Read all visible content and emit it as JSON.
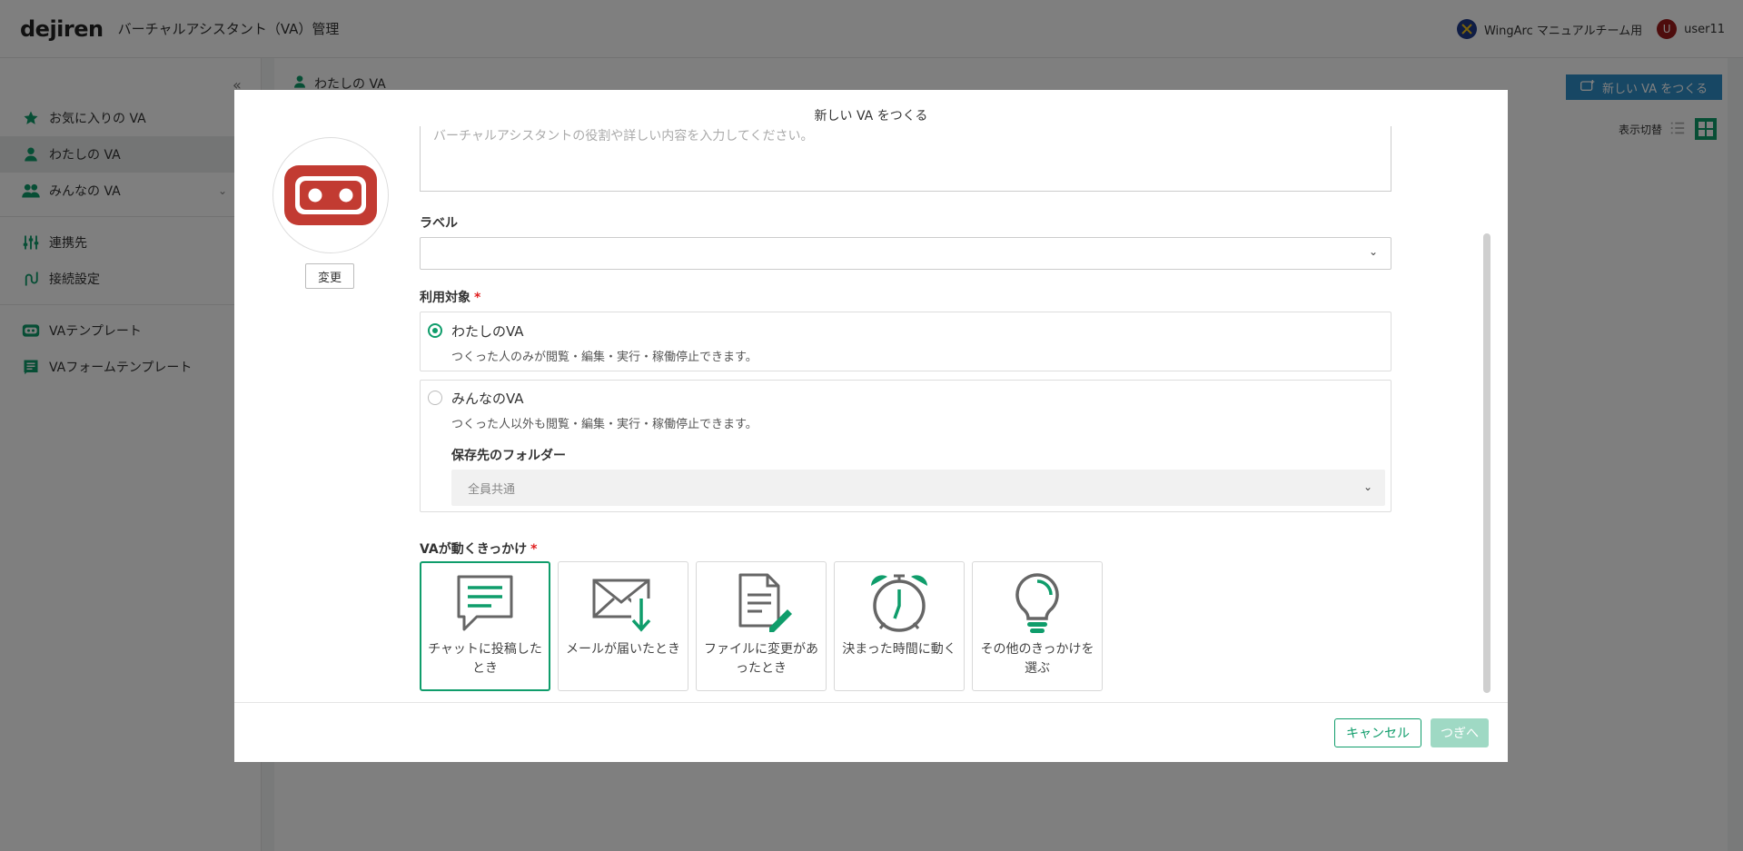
{
  "header": {
    "logo": "dejiren",
    "app_title": "バーチャルアシスタント（VA）管理",
    "team_name": "WingArc マニュアルチーム用",
    "user_initial": "U",
    "user_name": "user11"
  },
  "sidebar": {
    "items": [
      {
        "label": "お気に入りの VA",
        "icon": "star-icon"
      },
      {
        "label": "わたしの VA",
        "icon": "person-icon"
      },
      {
        "label": "みんなの VA",
        "icon": "people-icon"
      },
      {
        "label": "連携先",
        "icon": "sliders-icon"
      },
      {
        "label": "接続設定",
        "icon": "connection-icon"
      },
      {
        "label": "VAテンプレート",
        "icon": "va-template-icon"
      },
      {
        "label": "VAフォームテンプレート",
        "icon": "form-template-icon"
      }
    ]
  },
  "main": {
    "breadcrumb": "わたしの VA",
    "new_va_label": "新しい VA をつくる",
    "view_toggle_label": "表示切替"
  },
  "modal": {
    "title": "新しい VA をつくる",
    "change_label": "変更",
    "description_placeholder": "バーチャルアシスタントの役割や詳しい内容を入力してください。",
    "label_field": "ラベル",
    "target_label": "利用対象",
    "required_mark": "*",
    "options": [
      {
        "title": "わたしのVA",
        "desc": "つくった人のみが閲覧・編集・実行・稼働停止できます。",
        "selected": true
      },
      {
        "title": "みんなのVA",
        "desc": "つくった人以外も閲覧・編集・実行・稼働停止できます。",
        "selected": false
      }
    ],
    "folder_label": "保存先のフォルダー",
    "folder_value": "全員共通",
    "trigger_label": "VAが動くきっかけ",
    "triggers": [
      {
        "label": "チャットに投稿したとき",
        "icon": "chat-icon",
        "selected": true
      },
      {
        "label": "メールが届いたとき",
        "icon": "mail-download-icon",
        "selected": false
      },
      {
        "label": "ファイルに変更があったとき",
        "icon": "file-edit-icon",
        "selected": false
      },
      {
        "label": "決まった時間に動く",
        "icon": "alarm-clock-icon",
        "selected": false
      },
      {
        "label": "その他のきっかけを選ぶ",
        "icon": "lightbulb-icon",
        "selected": false
      }
    ],
    "cancel_label": "キャンセル",
    "next_label": "つぎへ"
  },
  "colors": {
    "accent": "#0f9d6b",
    "primary_button": "#2f8fc9",
    "avatar_red": "#c23b32"
  }
}
